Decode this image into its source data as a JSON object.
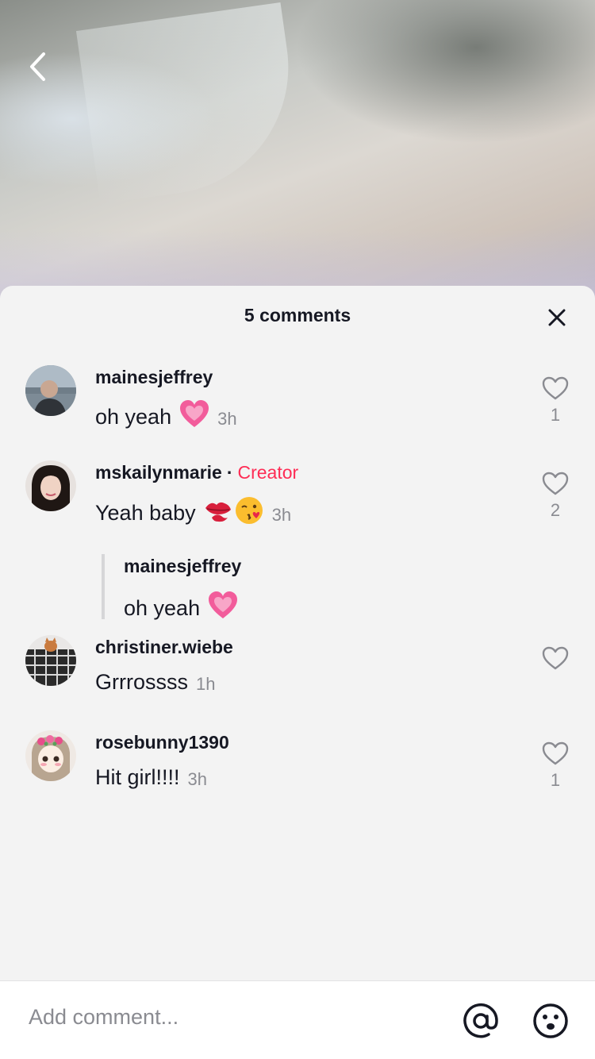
{
  "header": {
    "title": "5 comments"
  },
  "comments": [
    {
      "username": "mainesjeffrey",
      "text": "oh yeah",
      "emoji": [
        "growing-heart"
      ],
      "time": "3h",
      "likes": "1",
      "avatar": "man-by-lake"
    },
    {
      "username": "mskailynmarie",
      "creator_separator": "·",
      "creator_label": "Creator",
      "text": "Yeah baby",
      "emoji": [
        "kiss-mark",
        "face-blowing-kiss"
      ],
      "time": "3h",
      "likes": "2",
      "avatar": "woman-dark-hair",
      "reply_to": {
        "username": "mainesjeffrey",
        "text": "oh yeah",
        "emoji": [
          "growing-heart"
        ]
      }
    },
    {
      "username": "christiner.wiebe",
      "text": "Grrrossss",
      "emoji": [],
      "time": "1h",
      "likes": "",
      "avatar": "cat-on-plaid"
    },
    {
      "username": "rosebunny1390",
      "text": "Hit girl!!!!",
      "emoji": [],
      "time": "3h",
      "likes": "1",
      "avatar": "anime-girl-flower-crown"
    }
  ],
  "input": {
    "placeholder": "Add comment..."
  },
  "colors": {
    "creator": "#fe2c55",
    "sheet_background": "#f3f3f3",
    "text_primary": "#161823",
    "text_secondary": "#8a8b91"
  },
  "icons": {
    "back": "chevron-left-icon",
    "close": "close-icon",
    "like": "heart-outline-icon",
    "mention": "at-sign-icon",
    "emoji": "smiley-face-icon"
  }
}
